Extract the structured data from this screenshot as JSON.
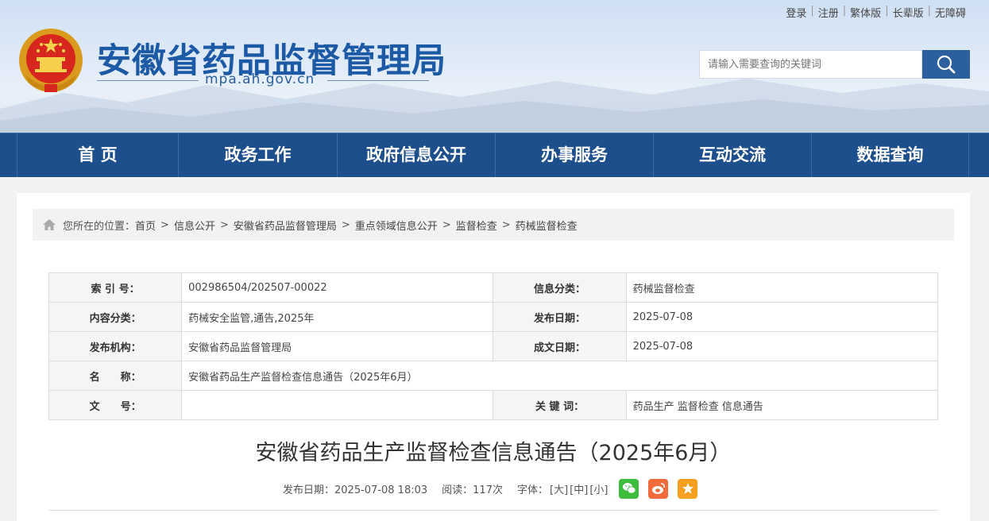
{
  "top_links": [
    "登录",
    "注册",
    "繁体版",
    "长辈版",
    "无障碍"
  ],
  "site": {
    "title": "安徽省药品监督管理局",
    "domain": "mpa.ah.gov.cn"
  },
  "search": {
    "placeholder": "请输入需要查询的关键词"
  },
  "nav": [
    "首 页",
    "政务工作",
    "政府信息公开",
    "办事服务",
    "互动交流",
    "数据查询"
  ],
  "breadcrumb": {
    "lead": "您所在的位置：",
    "items": [
      "首页",
      "信息公开",
      "安徽省药品监督管理局",
      "重点领域信息公开",
      "监督检查",
      "药械监督检查"
    ],
    "separator": ">"
  },
  "meta": {
    "index_label": "索 引 号：",
    "index_value": "002986504/202507-00022",
    "category_label": "信息分类：",
    "category_value": "药械监督检查",
    "content_type_label": "内容分类：",
    "content_type_value": "药械安全监管,通告,2025年",
    "publish_date_label": "发布日期：",
    "publish_date_value": "2025-07-08",
    "org_label": "发布机构：",
    "org_value": "安徽省药品监督管理局",
    "made_date_label": "成文日期：",
    "made_date_value": "2025-07-08",
    "name_label": "名　　称：",
    "name_value": "安徽省药品生产监督检查信息通告（2025年6月）",
    "doc_no_label": "文　　号：",
    "doc_no_value": "",
    "keywords_label": "关 键 词：",
    "keywords_value": "药品生产 监督检查 信息通告"
  },
  "article": {
    "title": "安徽省药品生产监督检查信息通告（2025年6月）",
    "publish": "发布日期：2025-07-08 18:03",
    "reads": "阅读：117次",
    "font_label": "字体：",
    "font_large": "[大]",
    "font_medium": "[中]",
    "font_small": "[小]"
  },
  "colors": {
    "nav_bg": "#1d4f8c",
    "title_blue": "#1d5aa6",
    "search_btn": "#2b5f9d"
  }
}
